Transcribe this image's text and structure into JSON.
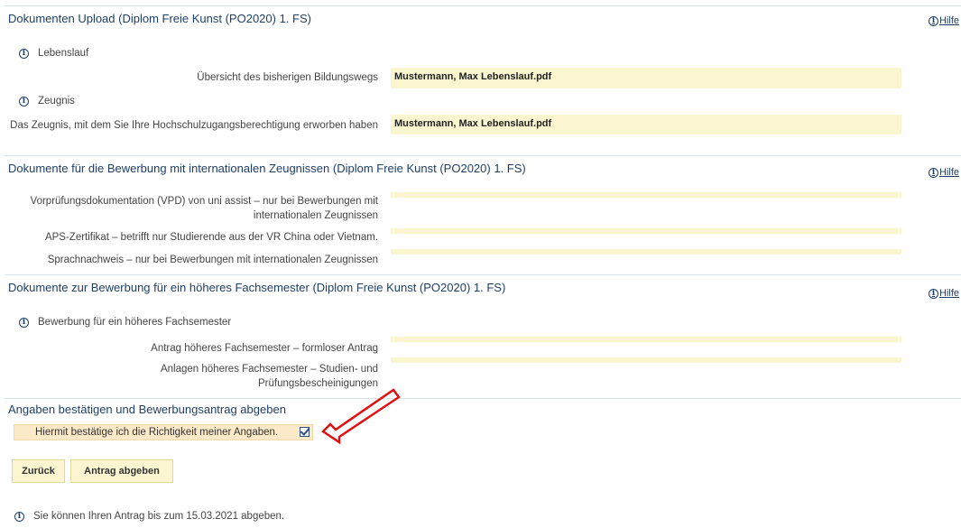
{
  "sections": {
    "upload": {
      "title": "Dokumenten Upload (Diplom Freie Kunst (PO2020) 1. FS)",
      "help": "Hilfe",
      "info_cv": "Lebenslauf",
      "cv_label": "Übersicht des bisherigen Bildungswegs",
      "cv_value": "Mustermann, Max Lebenslauf.pdf",
      "info_cert": "Zeugnis",
      "cert_label": "Das Zeugnis, mit dem Sie Ihre Hochschulzugangsberechtigung erworben haben",
      "cert_value": "Mustermann, Max Lebenslauf.pdf"
    },
    "international": {
      "title": "Dokumente für die Bewerbung mit internationalen Zeugnissen (Diplom Freie Kunst (PO2020) 1. FS)",
      "help": "Hilfe",
      "vpd_label": "Vorprüfungsdokumentation (VPD) von uni assist – nur bei Bewerbungen mit internationalen Zeugnissen",
      "aps_label": "APS-Zertifikat – betrifft nur Studierende aus der VR China oder Vietnam.",
      "lang_label": "Sprachnachweis – nur bei Bewerbungen mit internationalen Zeugnissen"
    },
    "higher_semester": {
      "title": "Dokumente zur Bewerbung für ein höheres Fachsemester (Diplom Freie Kunst (PO2020) 1. FS)",
      "help": "Hilfe",
      "info_text": "Bewerbung für ein höheres Fachsemester",
      "request_label": "Antrag höheres Fachsemester – formloser Antrag",
      "attachments_label": "Anlagen höheres Fachsemester – Studien- und Prüfungsbescheinigungen"
    },
    "confirm": {
      "title": "Angaben bestätigen und Bewerbungsantrag abgeben",
      "checkbox_label": "Hiermit bestätige ich die Richtigkeit meiner Angaben.",
      "checkbox_checked": true,
      "back_button": "Zurück",
      "submit_button": "Antrag abgeben",
      "deadline_info": "Sie können Ihren Antrag bis zum 15.03.2021 abgeben."
    }
  },
  "colors": {
    "title": "#1f3f66",
    "field_bg": "#fbf5d0",
    "confirm_bg": "#fbe9c8",
    "arrow": "#e01010"
  }
}
